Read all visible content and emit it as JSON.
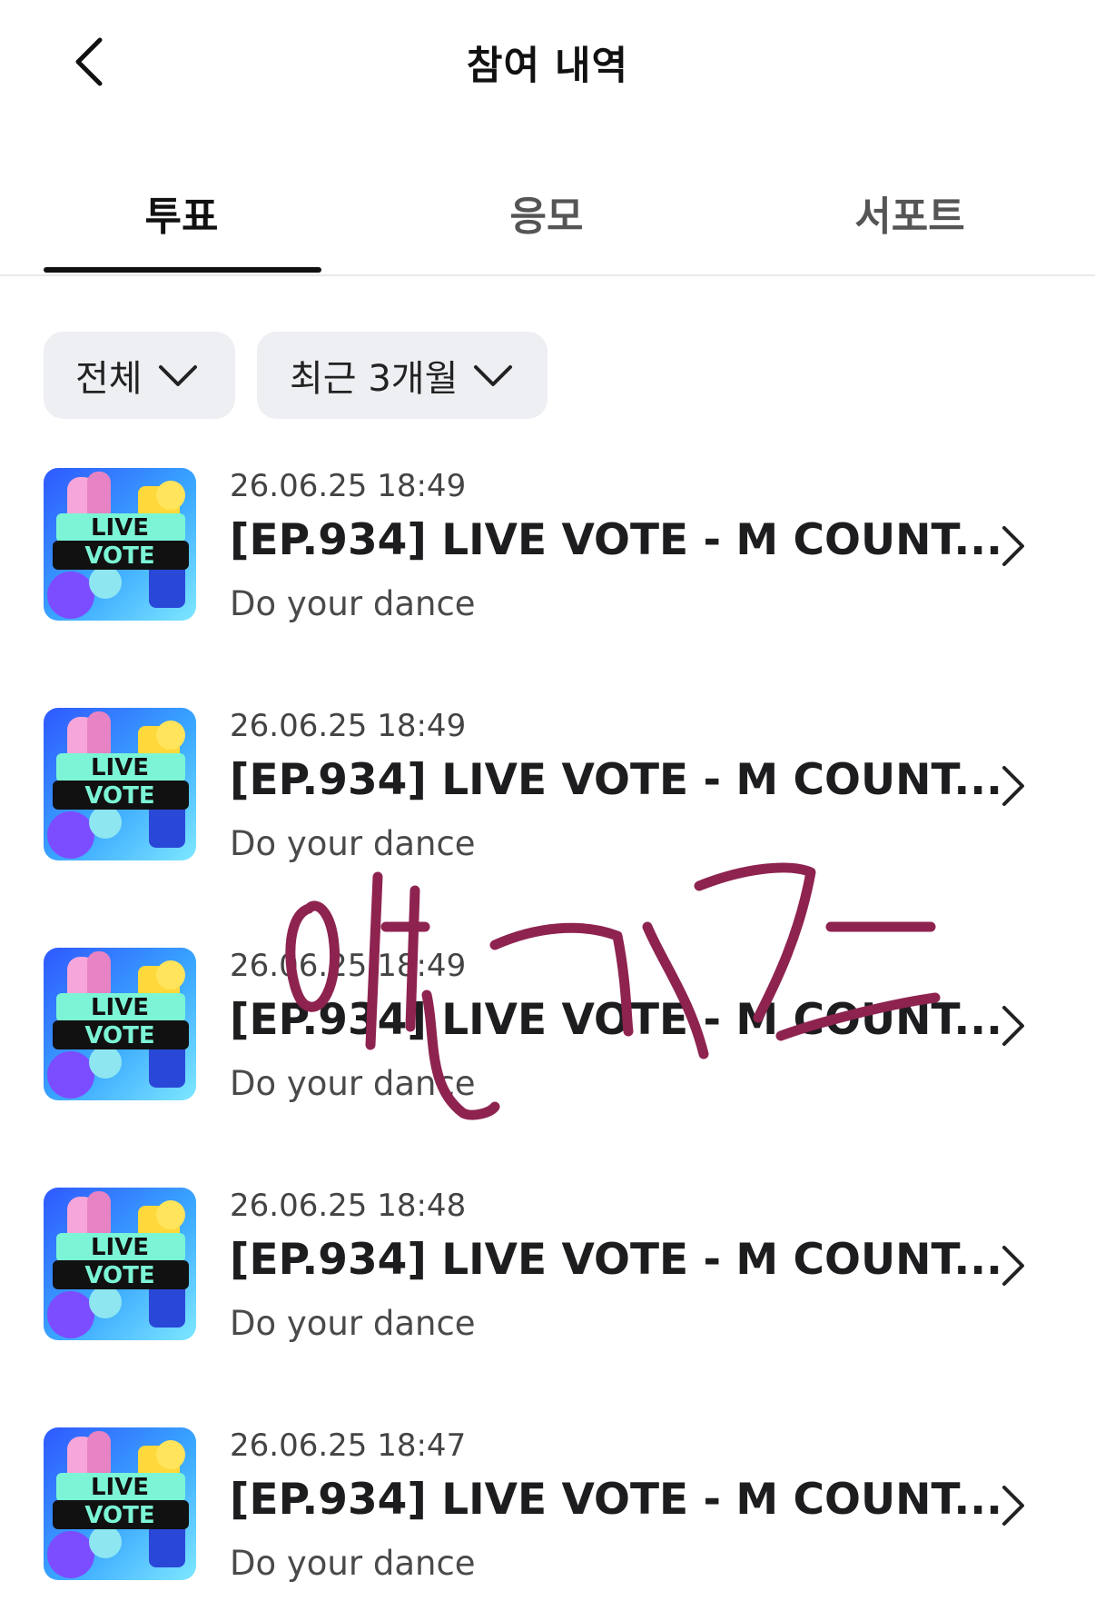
{
  "header": {
    "title": "참여 내역",
    "back_icon": "chevron-left-icon"
  },
  "tabs": [
    {
      "label": "투표",
      "active": true
    },
    {
      "label": "응모",
      "active": false
    },
    {
      "label": "서포트",
      "active": false
    }
  ],
  "filters": {
    "category": "전체",
    "period": "최근 3개월"
  },
  "thumbnail_text": {
    "line1": "LIVE",
    "line2": "VOTE"
  },
  "items": [
    {
      "date": "26.06.25 18:49",
      "title": "[EP.934] LIVE VOTE - M COUNT...",
      "subtitle": "Do your dance"
    },
    {
      "date": "26.06.25 18:49",
      "title": "[EP.934] LIVE VOTE - M COUNT...",
      "subtitle": "Do your dance"
    },
    {
      "date": "26.06.25 18:49",
      "title": "[EP.934] LIVE VOTE - M COUNT...",
      "subtitle": "Do your dance"
    },
    {
      "date": "26.06.25 18:48",
      "title": "[EP.934] LIVE VOTE - M COUNT...",
      "subtitle": "Do your dance"
    },
    {
      "date": "26.06.25 18:47",
      "title": "[EP.934] LIVE VOTE - M COUNT...",
      "subtitle": "Do your dance"
    }
  ],
  "colors": {
    "handwriting": "#8e2350",
    "active_tab": "#111111",
    "filter_bg": "#eeeff2"
  }
}
